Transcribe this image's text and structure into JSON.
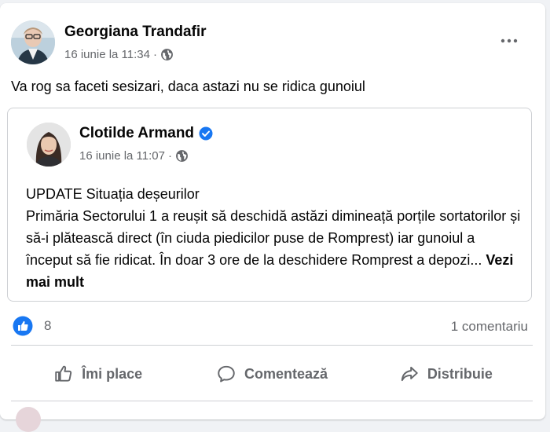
{
  "post": {
    "author": "Georgiana Trandafir",
    "timestamp": "16 iunie la 11:34",
    "separator": "·",
    "privacy_icon": "globe-icon",
    "text": "Va rog sa faceti sesizari, daca astazi nu se ridica gunoiul"
  },
  "shared": {
    "author": "Clotilde Armand",
    "verified_icon": "verified-badge-icon",
    "timestamp": "16 iunie la 11:07",
    "separator": "·",
    "title": "UPDATE Situația deșeurilor",
    "body": "Primăria Sectorului 1 a reușit să deschidă astăzi dimineață porțile sortatorilor și să-i plătească direct (în ciuda piedicilor puse de Romprest) iar gunoiul a început să fie ridicat. În doar 3 ore de la deschidere Romprest a depozi...",
    "see_more": "Vezi mai mult"
  },
  "stats": {
    "likes": "8",
    "comments": "1 comentariu"
  },
  "actions": {
    "like": "Îmi place",
    "comment": "Comentează",
    "share": "Distribuie"
  },
  "colors": {
    "accent": "#1877f2",
    "secondary_text": "#65676b",
    "divider": "#ced0d4"
  }
}
